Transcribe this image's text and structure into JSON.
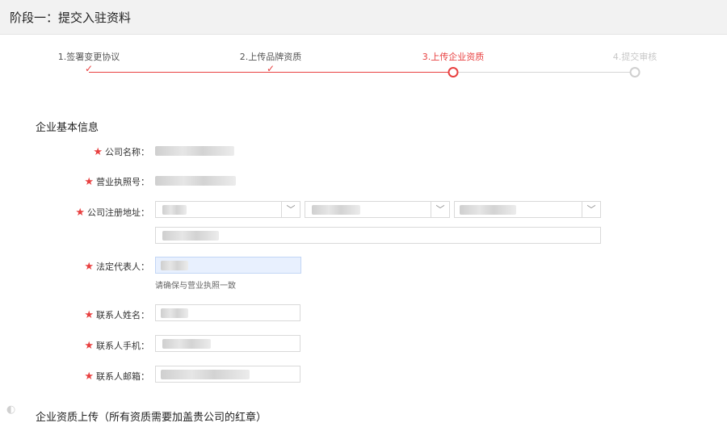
{
  "header": {
    "title": "阶段一：提交入驻资料"
  },
  "steps": [
    {
      "label": "1.签署变更协议",
      "state": "done"
    },
    {
      "label": "2.上传品牌资质",
      "state": "done"
    },
    {
      "label": "3.上传企业资质",
      "state": "active"
    },
    {
      "label": "4.提交审核",
      "state": "pending"
    }
  ],
  "form": {
    "section_title": "企业基本信息",
    "required_mark": "★",
    "fields": {
      "company_name": "公司名称：",
      "license_no": "营业执照号：",
      "address": "公司注册地址：",
      "legal_rep": "法定代表人：",
      "contact_name": "联系人姓名：",
      "contact_phone": "联系人手机：",
      "contact_email": "联系人邮箱："
    },
    "legal_rep_hint": "请确保与营业执照一致"
  },
  "upload": {
    "section_title": "企业资质上传（所有资质需要加盖贵公司的红章）"
  },
  "colors": {
    "accent": "#e84040",
    "pending": "#cfcfcf"
  },
  "icons": {
    "done": "check-icon",
    "select": "chevron-down-icon"
  }
}
